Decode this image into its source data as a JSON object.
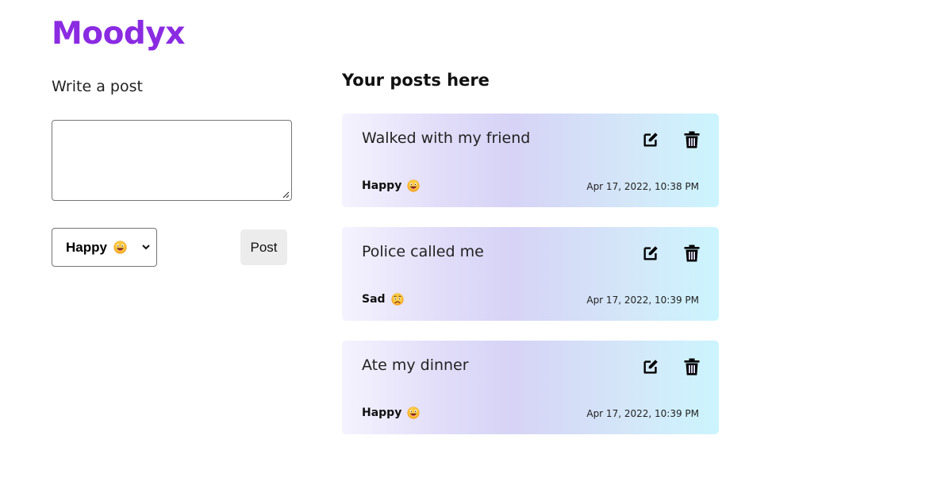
{
  "app": {
    "title": "Moodyx",
    "brand_color": "#8a2be2"
  },
  "compose": {
    "label": "Write a post",
    "textarea_value": "",
    "mood_selected": "Happy",
    "mood_emoji_icon": "grinning-face-icon",
    "post_label": "Post"
  },
  "feed": {
    "title": "Your posts here",
    "posts": [
      {
        "text": "Walked with my friend",
        "mood": "Happy",
        "mood_icon": "grinning-face-icon",
        "time": "Apr 17, 2022, 10:38 PM"
      },
      {
        "text": "Police called me",
        "mood": "Sad",
        "mood_icon": "frowning-face-icon",
        "time": "Apr 17, 2022, 10:39 PM"
      },
      {
        "text": "Ate my dinner",
        "mood": "Happy",
        "mood_icon": "grinning-face-icon",
        "time": "Apr 17, 2022, 10:39 PM"
      }
    ]
  }
}
